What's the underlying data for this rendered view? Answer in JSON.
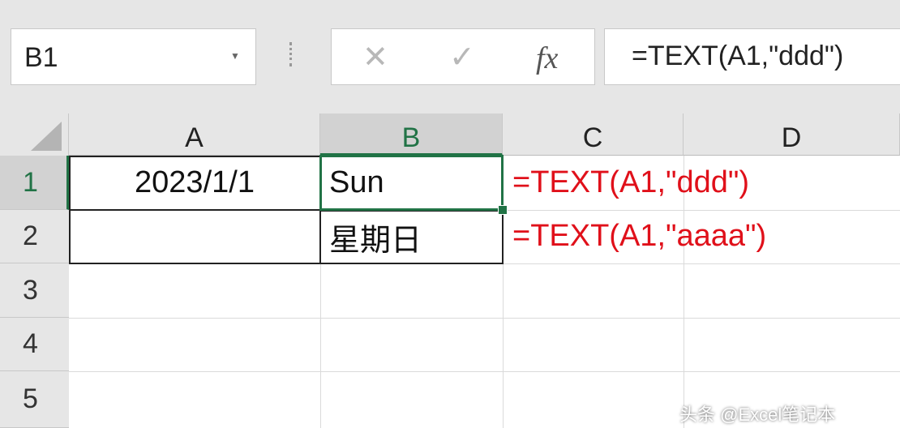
{
  "name_box": "B1",
  "formula_bar": {
    "cancel_icon": "✕",
    "enter_icon": "✓",
    "fx_label": "fx",
    "formula": "=TEXT(A1,\"ddd\")"
  },
  "columns": [
    "A",
    "B",
    "C",
    "D"
  ],
  "rows": [
    "1",
    "2",
    "3",
    "4",
    "5"
  ],
  "cells": {
    "A1": "2023/1/1",
    "B1": "Sun",
    "B2": "星期日"
  },
  "annotations": [
    "=TEXT(A1,\"ddd\")",
    "=TEXT(A1,\"aaaa\")"
  ],
  "watermark": "头条 @Excel笔记本",
  "colors": {
    "selection": "#217346",
    "annotation": "#e0101a"
  }
}
